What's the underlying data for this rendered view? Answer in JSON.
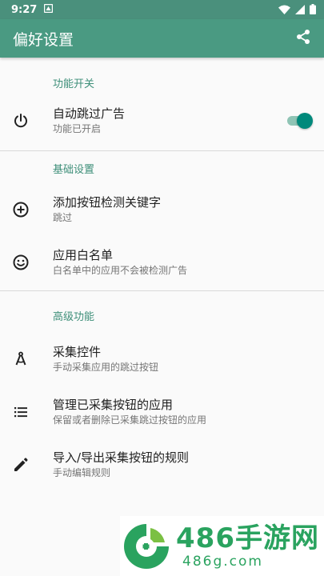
{
  "status_bar": {
    "time": "9:27"
  },
  "app_bar": {
    "title": "偏好设置"
  },
  "sections": [
    {
      "header": "功能开关",
      "items": [
        {
          "title": "自动跳过广告",
          "summary": "功能已开启",
          "icon": "power-icon",
          "switch_on": true
        }
      ]
    },
    {
      "header": "基础设置",
      "items": [
        {
          "title": "添加按钮检测关键字",
          "summary": "跳过",
          "icon": "add-circle-icon"
        },
        {
          "title": "应用白名单",
          "summary": "白名单中的应用不会被检测广告",
          "icon": "smiley-icon"
        }
      ]
    },
    {
      "header": "高级功能",
      "items": [
        {
          "title": "采集控件",
          "summary": "手动采集应用的跳过按钮",
          "icon": "compass-icon"
        },
        {
          "title": "管理已采集按钮的应用",
          "summary": "保留或者删除已采集跳过按钮的应用",
          "icon": "list-icon"
        },
        {
          "title": "导入/导出采集按钮的规则",
          "summary": "手动编辑规则",
          "icon": "pencil-icon"
        }
      ]
    }
  ],
  "watermark": {
    "big": "486手游网",
    "small": "486g.com"
  },
  "colors": {
    "primary": "#4a9a82",
    "accent": "#00897b",
    "section_header": "#3e8f79"
  }
}
